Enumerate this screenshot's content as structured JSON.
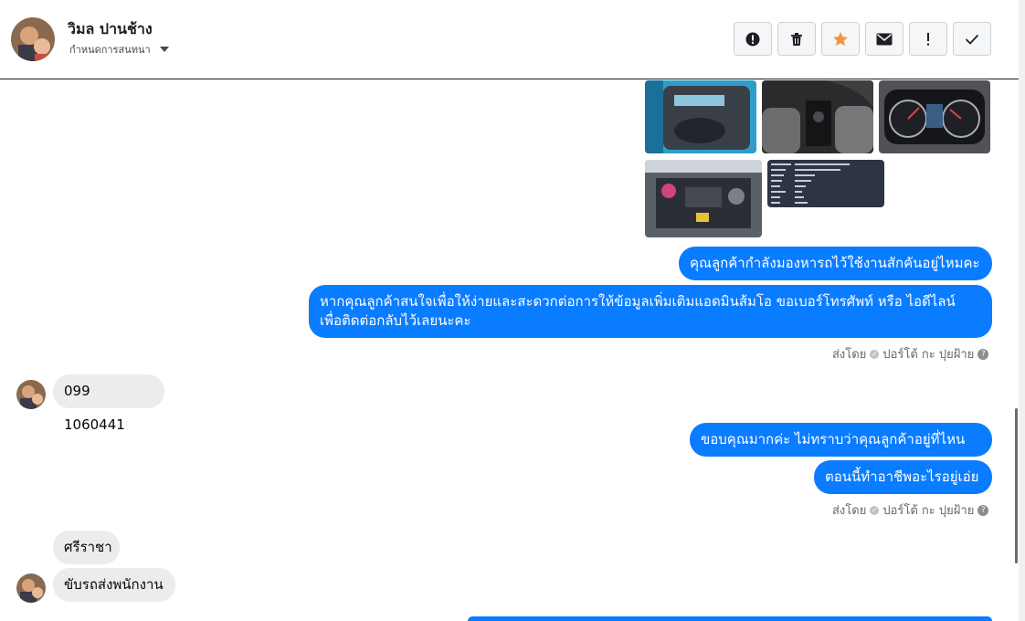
{
  "header": {
    "name": "วิมล ปานช้าง",
    "stage_label": "กำหนดการสนทนา"
  },
  "actions": [
    {
      "icon": "alert-circle-icon"
    },
    {
      "icon": "trash-icon"
    },
    {
      "icon": "star-icon",
      "color": "#f7923b"
    },
    {
      "icon": "envelope-icon"
    },
    {
      "icon": "exclamation-icon"
    },
    {
      "icon": "check-icon"
    }
  ],
  "messages": {
    "out_1": "คุณลูกค้ากำลังมองหารถไว้ใช้งานสักคันอยู่ไหมคะ",
    "out_2_line1": "หากคุณลูกค้าสนใจเพื่อให้ง่ายและสะดวกต่อการให้ข้อมูลเพิ่มเติมแอดมินส้มโอ ขอเบอร์โทรศัพท์ หรือ ไอดีไลน์",
    "out_2_line2": "เพื่อติดต่อกลับไว้เลยนะคะ",
    "sent_by_1": "ส่งโดย",
    "sender_1": "ปอร์โต้ กะ ปุยฝ้าย",
    "in_1": "099  1060441",
    "out_3": "ขอบคุณมากค่ะ ไม่ทราบว่าคุณลูกค้าอยู่ที่ไหนคะ",
    "out_4": "ตอนนี้ทำอาชีพอะไรอยู่เอ่ย",
    "sent_by_2": "ส่งโดย",
    "sender_2": "ปอร์โต้ กะ ปุยฝ้าย",
    "in_2": "ศรีราชา",
    "in_3": "ขับรถส่งพนักงาน"
  },
  "colors": {
    "outgoing_bubble": "#0a7cff",
    "incoming_bubble": "#ececec"
  }
}
